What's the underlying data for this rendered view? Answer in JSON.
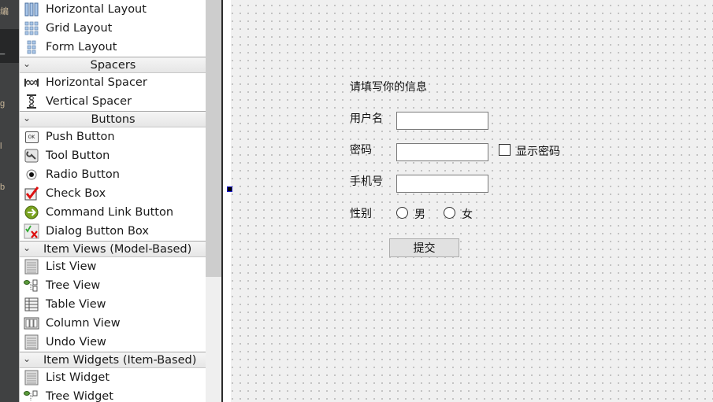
{
  "left_mode_bar": {
    "glyphs": [
      "编",
      "_",
      "g",
      "l",
      "b"
    ]
  },
  "widget_box": {
    "sections": [
      {
        "category": null,
        "items": [
          {
            "label": "Horizontal Layout",
            "icon": "horizontal-layout-icon"
          },
          {
            "label": "Grid Layout",
            "icon": "grid-layout-icon"
          },
          {
            "label": "Form Layout",
            "icon": "form-layout-icon"
          }
        ]
      },
      {
        "category": "Spacers",
        "items": [
          {
            "label": "Horizontal Spacer",
            "icon": "horizontal-spacer-icon"
          },
          {
            "label": "Vertical Spacer",
            "icon": "vertical-spacer-icon"
          }
        ]
      },
      {
        "category": "Buttons",
        "items": [
          {
            "label": "Push Button",
            "icon": "push-button-icon"
          },
          {
            "label": "Tool Button",
            "icon": "tool-button-icon"
          },
          {
            "label": "Radio Button",
            "icon": "radio-button-icon"
          },
          {
            "label": "Check Box",
            "icon": "check-box-icon"
          },
          {
            "label": "Command Link Button",
            "icon": "command-link-icon"
          },
          {
            "label": "Dialog Button Box",
            "icon": "dialog-button-box-icon"
          }
        ]
      },
      {
        "category": "Item Views (Model-Based)",
        "items": [
          {
            "label": "List View",
            "icon": "list-view-icon"
          },
          {
            "label": "Tree View",
            "icon": "tree-view-icon"
          },
          {
            "label": "Table View",
            "icon": "table-view-icon"
          },
          {
            "label": "Column View",
            "icon": "column-view-icon"
          },
          {
            "label": "Undo View",
            "icon": "undo-view-icon"
          }
        ]
      },
      {
        "category": "Item Widgets (Item-Based)",
        "items": [
          {
            "label": "List Widget",
            "icon": "list-widget-icon"
          },
          {
            "label": "Tree Widget",
            "icon": "tree-widget-icon"
          }
        ]
      }
    ],
    "push_button_icon_text": "OK"
  },
  "form": {
    "title": "请填写你的信息",
    "username_label": "用户名",
    "username_value": "",
    "password_label": "密码",
    "password_value": "",
    "show_password_label": "显示密码",
    "show_password_checked": false,
    "phone_label": "手机号",
    "phone_value": "",
    "gender_label": "性别",
    "gender_options": [
      "男",
      "女"
    ],
    "gender_selected": null,
    "submit_label": "提交"
  }
}
